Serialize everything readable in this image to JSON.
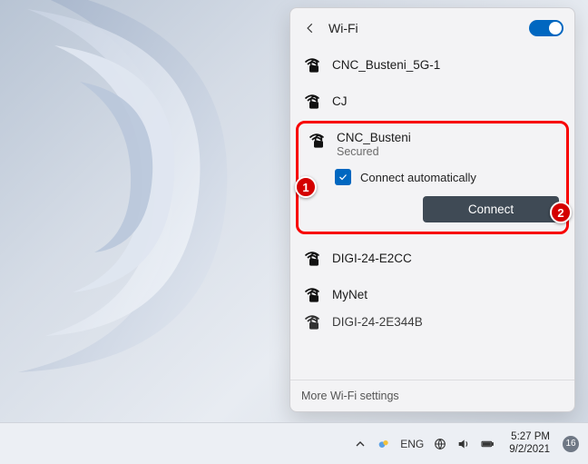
{
  "header": {
    "title": "Wi-Fi",
    "toggle_on": true
  },
  "networks": {
    "above": [
      {
        "name": "CNC_Busteni_5G-1",
        "secured": true
      },
      {
        "name": "CJ",
        "secured": true
      }
    ],
    "selected": {
      "name": "CNC_Busteni",
      "status": "Secured",
      "auto_label": "Connect automatically",
      "auto_checked": true,
      "connect_label": "Connect"
    },
    "below": [
      {
        "name": "DIGI-24-E2CC",
        "secured": true
      },
      {
        "name": "MyNet",
        "secured": true
      },
      {
        "name": "DIGI-24-2E344B",
        "secured": true
      }
    ]
  },
  "footer": {
    "more": "More Wi-Fi settings"
  },
  "callouts": {
    "one": "1",
    "two": "2"
  },
  "taskbar": {
    "lang": "ENG",
    "time": "5:27 PM",
    "date": "9/2/2021",
    "notif_count": "16"
  }
}
